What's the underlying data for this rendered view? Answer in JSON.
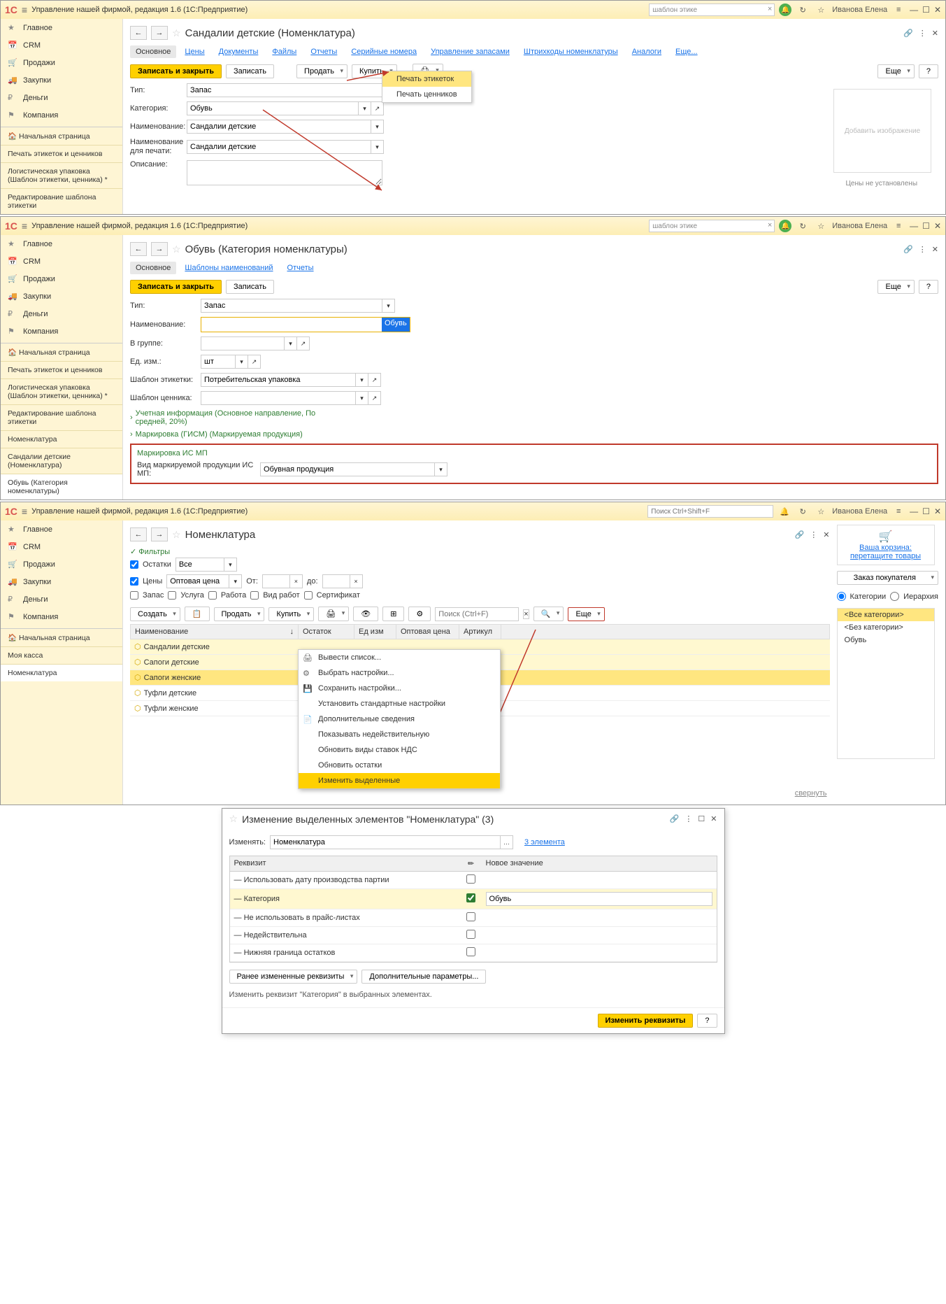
{
  "common": {
    "app_title": "Управление нашей фирмой, редакция 1.6  (1С:Предприятие)",
    "search_value": "шаблон этике",
    "search_placeholder": "Поиск Ctrl+Shift+F",
    "user": "Иванова Елена",
    "more_btn": "Еще",
    "help_btn": "?",
    "save_close": "Записать и закрыть",
    "save": "Записать"
  },
  "nav": {
    "main": "Главное",
    "crm": "CRM",
    "sales": "Продажи",
    "purchases": "Закупки",
    "money": "Деньги",
    "company": "Компания",
    "home": "Начальная страница"
  },
  "win1": {
    "sections": {
      "labels": "Печать этикеток и ценников",
      "logistic": "Логистическая упаковка (Шаблон этикетки, ценника) *",
      "edit_template": "Редактирование шаблона этикетки"
    },
    "title": "Сандалии детские (Номенклатура)",
    "tabs": {
      "osn": "Основное",
      "prices": "Цены",
      "docs": "Документы",
      "files": "Файлы",
      "reports": "Отчеты",
      "serial": "Серийные номера",
      "stock": "Управление запасами",
      "barcodes": "Штрихкоды номенклатуры",
      "analogs": "Аналоги",
      "more": "Еще..."
    },
    "sell": "Продать",
    "buy": "Купить",
    "print_menu": {
      "labels": "Печать этикеток",
      "prices": "Печать ценников"
    },
    "f": {
      "type": "Тип:",
      "type_v": "Запас",
      "cat": "Категория:",
      "cat_v": "Обувь",
      "name": "Наименование:",
      "name_v": "Сандалии детские",
      "pname": "Наименование для печати:",
      "pname_v": "Сандалии детские",
      "desc": "Описание:"
    },
    "img_ph": "Добавить изображение",
    "prices_note": "Цены не установлены"
  },
  "win2": {
    "sections": {
      "labels": "Печать этикеток и ценников",
      "logistic": "Логистическая упаковка (Шаблон этикетки, ценника) *",
      "edit_template": "Редактирование шаблона этикетки",
      "nomen": "Номенклатура",
      "sandals": "Сандалии детские (Номенклатура)",
      "shoes": "Обувь (Категория номенклатуры)"
    },
    "title": "Обувь (Категория номенклатуры)",
    "tabs": {
      "osn": "Основное",
      "templates": "Шаблоны наименований",
      "reports": "Отчеты"
    },
    "f": {
      "type": "Тип:",
      "type_v": "Запас",
      "name": "Наименование:",
      "name_v": "Обувь",
      "group": "В группе:",
      "unit": "Ед. изм.:",
      "unit_v": "шт",
      "label_tmpl": "Шаблон этикетки:",
      "label_tmpl_v": "Потребительская упаковка",
      "price_tmpl": "Шаблон ценника:"
    },
    "exp1": "Учетная информация (Основное направление, По средней, 20%)",
    "exp2": "Маркировка (ГИСМ) (Маркируемая продукция)",
    "mark_title": "Маркировка ИС МП",
    "mark_label": "Вид маркируемой продукции ИС МП:",
    "mark_value": "Обувная продукция"
  },
  "win3": {
    "sections": {
      "kassa": "Моя касса",
      "nomen": "Номенклатура"
    },
    "title": "Номенклатура",
    "filters": {
      "header": "Фильтры",
      "ost": "Остатки",
      "ost_v": "Все",
      "prices": "Цены",
      "prices_v": "Оптовая цена",
      "from": "От:",
      "to": "до:",
      "zapas": "Запас",
      "usluga": "Услуга",
      "rabota": "Работа",
      "vidrabot": "Вид работ",
      "cert": "Сертификат"
    },
    "create": "Создать",
    "sell": "Продать",
    "buy": "Купить",
    "list_search": "Поиск (Ctrl+F)",
    "cart": {
      "title": "Ваша корзина:",
      "sub": "перетащите товары",
      "order": "Заказ покупателя"
    },
    "cat_radio": {
      "cats": "Категории",
      "hier": "Иерархия"
    },
    "cat_items": {
      "all": "<Все категории>",
      "none": "<Без категории>",
      "shoes": "Обувь"
    },
    "cols": {
      "name": "Наименование",
      "rest": "Остаток",
      "unit": "Ед изм",
      "price": "Оптовая цена",
      "art": "Артикул"
    },
    "rows": [
      "Сандалии детские",
      "Сапоги детские",
      "Сапоги женские",
      "Туфли детские",
      "Туфли женские"
    ],
    "menu": {
      "export": "Вывести список...",
      "choose": "Выбрать настройки...",
      "save_s": "Сохранить настройки...",
      "std": "Установить стандартные настройки",
      "extra": "Дополнительные сведения",
      "show_inv": "Показывать недействительную",
      "upd_vat": "Обновить виды ставок НДС",
      "upd_rest": "Обновить остатки",
      "edit_sel": "Изменить выделенные"
    },
    "collapse": "свернуть"
  },
  "dialog": {
    "title": "Изменение выделенных элементов \"Номенклатура\" (3)",
    "change": "Изменять:",
    "change_v": "Номенклатура",
    "elements": "3 элемента",
    "cols": {
      "rek": "Реквизит",
      "newval": "Новое значение"
    },
    "rows": {
      "r1": "Использовать дату производства партии",
      "r2": "Категория",
      "r2v": "Обувь",
      "r3": "Не использовать в прайс-листах",
      "r4": "Недействительна",
      "r5": "Нижняя граница остатков"
    },
    "prev": "Ранее измененные реквизиты",
    "additional": "Дополнительные параметры...",
    "hint": "Изменить реквизит \"Категория\" в выбранных элементах.",
    "apply": "Изменить реквизиты"
  }
}
